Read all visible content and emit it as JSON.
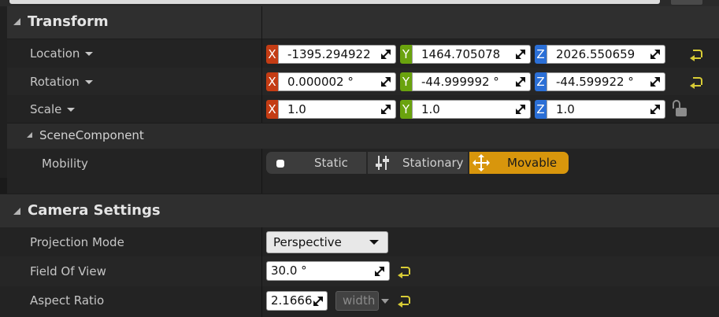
{
  "transform": {
    "title": "Transform",
    "location": {
      "label": "Location",
      "x": "-1395.294922",
      "y": "1464.705078",
      "z": "2026.550659"
    },
    "rotation": {
      "label": "Rotation",
      "x": "0.000002 °",
      "y": "-44.999992 °",
      "z": "-44.599922 °"
    },
    "scale": {
      "label": "Scale",
      "x": "1.0",
      "y": "1.0",
      "z": "1.0"
    },
    "axis_labels": {
      "x": "X",
      "y": "Y",
      "z": "Z"
    }
  },
  "scene_component": {
    "title": "SceneComponent",
    "mobility": {
      "label": "Mobility",
      "options": [
        "Static",
        "Stationary",
        "Movable"
      ],
      "selected": "Movable"
    }
  },
  "camera_settings": {
    "title": "Camera Settings",
    "projection_mode": {
      "label": "Projection Mode",
      "value": "Perspective"
    },
    "field_of_view": {
      "label": "Field Of View",
      "value": "30.0 °"
    },
    "aspect_ratio": {
      "label": "Aspect Ratio",
      "value": "2.1666",
      "lock_axis": "width"
    }
  },
  "colors": {
    "axis_x": "#c43c14",
    "axis_y": "#6aa30e",
    "axis_z": "#2b6fd6",
    "mobility_active": "#d8960c",
    "reset_arrow": "#d8cc36"
  },
  "icons": {
    "reset": "reset-to-default-icon",
    "lock": "unlocked-padlock-icon",
    "static": "static-dot-icon",
    "stationary": "stationary-sliders-icon",
    "movable": "movable-arrows-icon"
  }
}
